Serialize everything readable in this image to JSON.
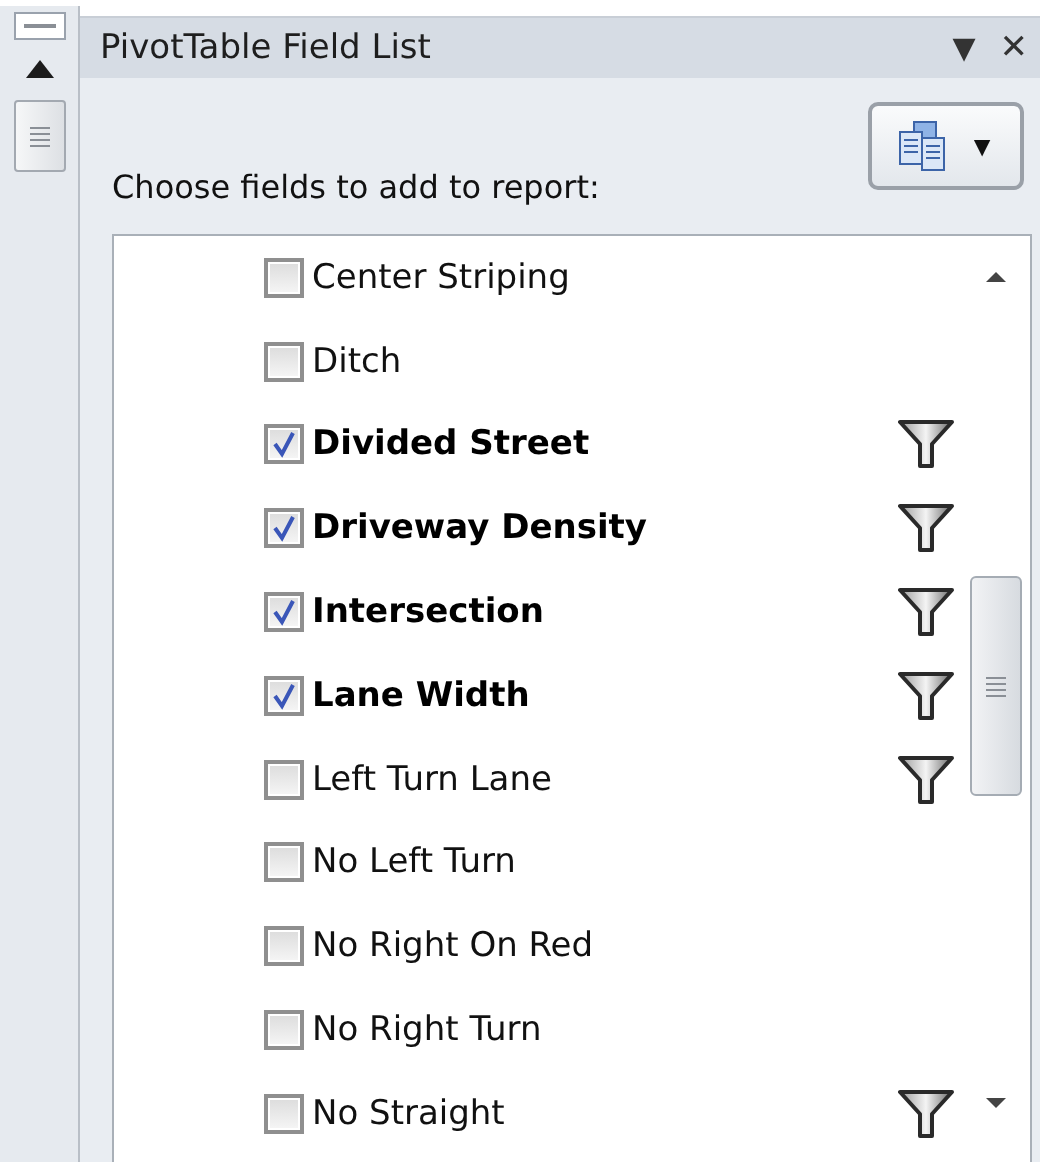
{
  "panel": {
    "title": "PivotTable Field List",
    "menu_glyph": "▼",
    "close_glyph": "✕",
    "prompt": "Choose fields to add to report:",
    "layout_button_caret": "▼"
  },
  "fields": [
    {
      "label": "Center Striping",
      "checked": false,
      "filtered": false
    },
    {
      "label": "Ditch",
      "checked": false,
      "filtered": false
    },
    {
      "label": "Divided Street",
      "checked": true,
      "filtered": true
    },
    {
      "label": "Driveway Density",
      "checked": true,
      "filtered": true
    },
    {
      "label": "Intersection",
      "checked": true,
      "filtered": true
    },
    {
      "label": "Lane Width",
      "checked": true,
      "filtered": true
    },
    {
      "label": "Left Turn Lane",
      "checked": false,
      "filtered": true
    },
    {
      "label": "No Left Turn",
      "checked": false,
      "filtered": false
    },
    {
      "label": "No Right On Red",
      "checked": false,
      "filtered": false
    },
    {
      "label": "No Right Turn",
      "checked": false,
      "filtered": false
    },
    {
      "label": "No Straight",
      "checked": false,
      "filtered": true
    }
  ]
}
